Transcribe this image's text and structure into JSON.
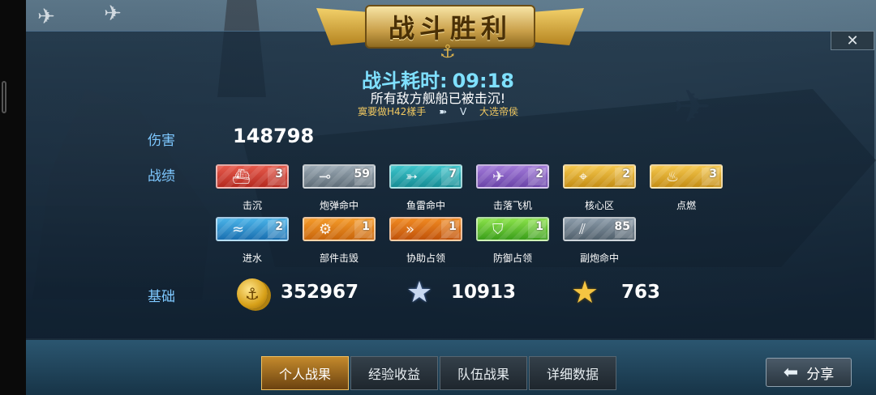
{
  "banner": {
    "title": "战斗胜利"
  },
  "battle": {
    "time_label": "战斗耗时:",
    "time_value": "09:18",
    "message": "所有敌方舰船已被击沉!",
    "killer": "寞要做H42樣手",
    "kill_separator": "V",
    "victim": "大选帝侯"
  },
  "damage": {
    "label": "伤害",
    "value": "148798"
  },
  "record": {
    "label": "战绩",
    "badges": [
      {
        "name": "击沉",
        "count": "3",
        "color": "red",
        "icon": "sinking-ship-icon"
      },
      {
        "name": "炮弹命中",
        "count": "59",
        "color": "grey",
        "icon": "shell-hit-icon"
      },
      {
        "name": "鱼雷命中",
        "count": "7",
        "color": "teal",
        "icon": "torpedo-icon"
      },
      {
        "name": "击落飞机",
        "count": "2",
        "color": "purple",
        "icon": "plane-down-icon"
      },
      {
        "name": "核心区",
        "count": "2",
        "color": "gold",
        "icon": "core-zone-icon"
      },
      {
        "name": "点燃",
        "count": "3",
        "color": "gold",
        "icon": "fire-icon"
      },
      {
        "name": "进水",
        "count": "2",
        "color": "blue",
        "icon": "flooding-icon"
      },
      {
        "name": "部件击毁",
        "count": "1",
        "color": "orange",
        "icon": "gear-icon"
      },
      {
        "name": "协助占领",
        "count": "1",
        "color": "amber",
        "icon": "assist-capture-icon"
      },
      {
        "name": "防御占领",
        "count": "1",
        "color": "green",
        "icon": "defend-capture-icon"
      },
      {
        "name": "副炮命中",
        "count": "85",
        "color": "slate",
        "icon": "secondary-gun-icon"
      }
    ]
  },
  "base": {
    "label": "基础",
    "silver": "352967",
    "experience": "10913",
    "captain_exp": "763"
  },
  "tabs": [
    "个人战果",
    "经验收益",
    "队伍战果",
    "详细数据"
  ],
  "share_label": "分享"
}
